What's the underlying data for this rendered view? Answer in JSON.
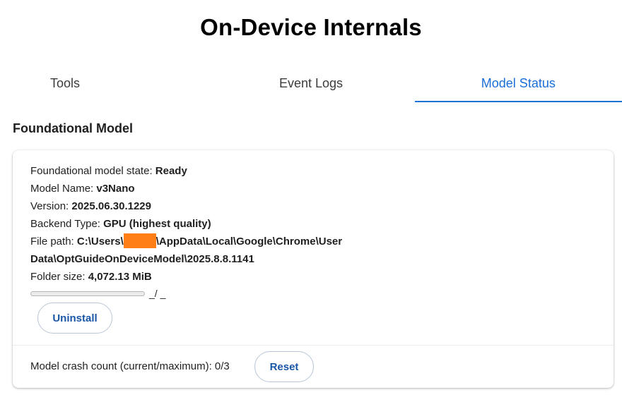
{
  "header": {
    "title": "On-Device Internals"
  },
  "tabs": [
    {
      "label": "Tools",
      "active": false
    },
    {
      "label": "Event Logs",
      "active": false
    },
    {
      "label": "Model Status",
      "active": true
    }
  ],
  "section": {
    "title": "Foundational Model"
  },
  "model": {
    "state_label": "Foundational model state: ",
    "state_value": "Ready",
    "name_label": "Model Name: ",
    "name_value": "v3Nano",
    "version_label": "Version: ",
    "version_value": "2025.06.30.1229",
    "backend_label": "Backend Type: ",
    "backend_value": "GPU (highest quality)",
    "path_label": "File path: ",
    "path_value_part1": "C:\\Users\\",
    "path_value_part2": "\\AppData\\Local\\Google\\Chrome\\User",
    "path_value_line2": "Data\\OptGuideOnDeviceModel\\2025.8.8.1141",
    "folder_label": "Folder size: ",
    "folder_value": "4,072.13 MiB",
    "progress_text": "_/ _",
    "progress_fraction": 0,
    "uninstall_label": "Uninstall"
  },
  "crash": {
    "label": "Model crash count (current/maximum): 0/3",
    "reset_label": "Reset"
  },
  "colors": {
    "accent": "#1a6ed8",
    "button_text": "#1a56a6",
    "redaction": "#ff7f16"
  }
}
